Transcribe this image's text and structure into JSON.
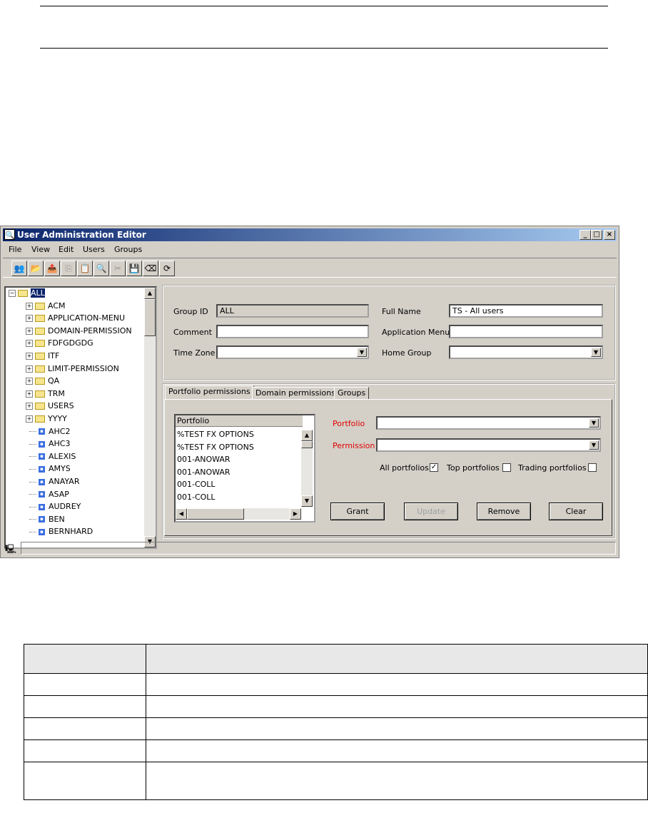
{
  "window": {
    "title": "User Administration Editor",
    "controls": [
      "_",
      "□",
      "×"
    ]
  },
  "menu": [
    "File",
    "View",
    "Edit",
    "Users",
    "Groups"
  ],
  "toolbar": {
    "icons": [
      {
        "name": "users-icon",
        "glyph": "👥",
        "enabled": true
      },
      {
        "name": "open-icon",
        "glyph": "📂",
        "enabled": false
      },
      {
        "name": "export-icon",
        "glyph": "📤",
        "enabled": true
      },
      {
        "name": "copy-icon",
        "glyph": "⎘",
        "enabled": false
      },
      {
        "name": "paste-icon",
        "glyph": "📋",
        "enabled": false
      },
      {
        "name": "find-icon",
        "glyph": "🔍",
        "enabled": true
      },
      {
        "name": "cut-icon",
        "glyph": "✂",
        "enabled": false
      },
      {
        "name": "save-icon",
        "glyph": "💾",
        "enabled": true
      },
      {
        "name": "eraser-icon",
        "glyph": "⌫",
        "enabled": true
      },
      {
        "name": "refresh-icon",
        "glyph": "⟳",
        "enabled": true
      }
    ]
  },
  "tree": {
    "root": "ALL",
    "groups": [
      "ACM",
      "APPLICATION-MENU",
      "DOMAIN-PERMISSION",
      "FDFGDGDG",
      "ITF",
      "LIMIT-PERMISSION",
      "QA",
      "TRM",
      "USERS",
      "YYYY"
    ],
    "users": [
      "AHC2",
      "AHC3",
      "ALEXIS",
      "AMYS",
      "ANAYAR",
      "ASAP",
      "AUDREY",
      "BEN",
      "BERNHARD"
    ]
  },
  "group_form": {
    "group_id_label": "Group ID",
    "group_id_value": "ALL",
    "full_name_label": "Full Name",
    "full_name_value": "TS - All users",
    "comment_label": "Comment",
    "comment_value": "",
    "app_menu_label": "Application Menu",
    "app_menu_value": "",
    "time_zone_label": "Time Zone",
    "time_zone_value": "",
    "home_group_label": "Home Group",
    "home_group_value": ""
  },
  "tabs": [
    "Portfolio permissions",
    "Domain permissions",
    "Groups"
  ],
  "portfolio_tab": {
    "list_header": "Portfolio",
    "list_items": [
      "%TEST FX OPTIONS",
      "%TEST FX OPTIONS",
      "001-ANOWAR",
      "001-ANOWAR",
      "001-COLL",
      "001-COLL"
    ],
    "portfolio_label": "Portfolio",
    "permission_label": "Permission",
    "label_color": "#e00000",
    "all_portfolios_label": "All portfolios",
    "all_portfolios_checked": true,
    "top_portfolios_label": "Top portfolios",
    "trading_portfolios_label": "Trading portfolios",
    "buttons": {
      "grant": "Grant",
      "update": "Update",
      "remove": "Remove",
      "clear": "Clear"
    }
  },
  "colors": {
    "titlebar_start": "#0a246a",
    "titlebar_end": "#a6caf0",
    "face": "#d4d0c8"
  }
}
